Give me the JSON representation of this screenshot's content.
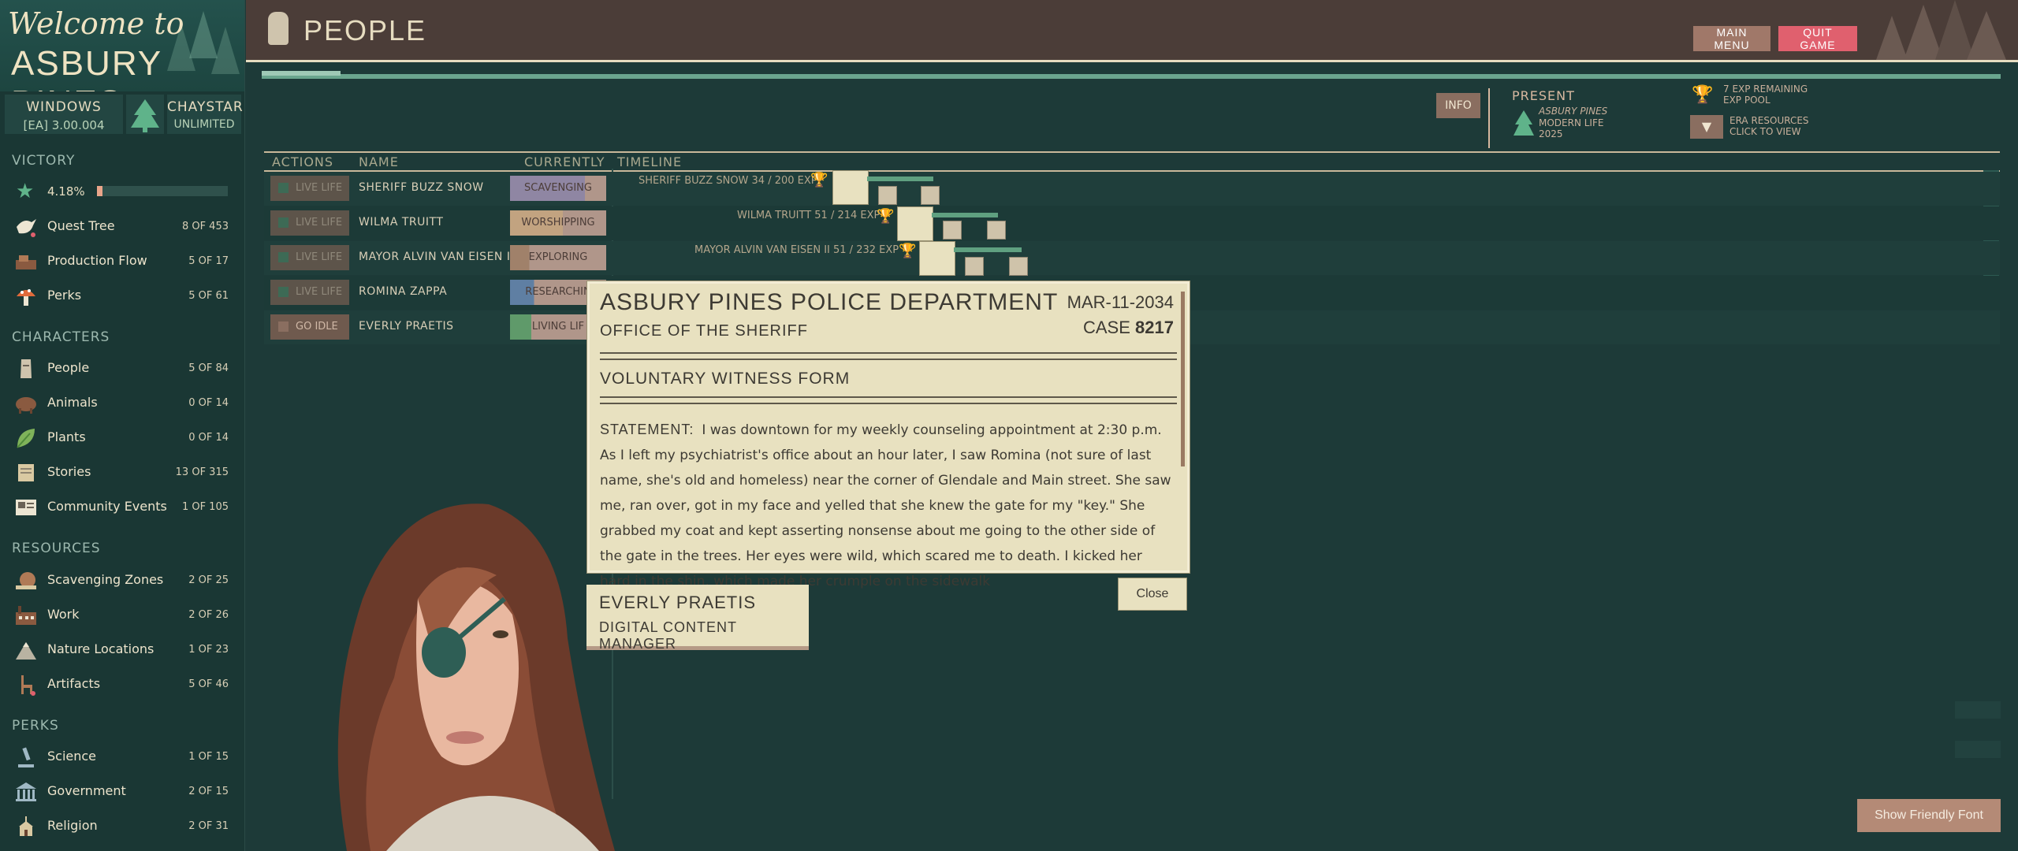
{
  "sidebar": {
    "logo": {
      "line1": "Welcome to",
      "line2": "ASBURY PINES"
    },
    "version": {
      "platform": "WINDOWS",
      "build": "[EA] 3.00.004"
    },
    "chaystar": {
      "name": "CHAYSTAR",
      "status": "UNLIMITED"
    },
    "victory": {
      "header": "VICTORY",
      "percent": "4.18%",
      "progress": 0.0418
    },
    "sections": {
      "victory_items": [
        {
          "label": "Quest Tree",
          "count": "8 OF 453",
          "icon": "dove-icon"
        },
        {
          "label": "Production Flow",
          "count": "5 OF 17",
          "icon": "conveyor-icon"
        },
        {
          "label": "Perks",
          "count": "5 OF 61",
          "icon": "mushroom-icon"
        }
      ],
      "characters_header": "CHARACTERS",
      "characters": [
        {
          "label": "People",
          "count": "5 OF 84",
          "icon": "moai-icon"
        },
        {
          "label": "Animals",
          "count": "0 OF 14",
          "icon": "bison-icon"
        },
        {
          "label": "Plants",
          "count": "0 OF 14",
          "icon": "leaf-icon"
        },
        {
          "label": "Stories",
          "count": "13 OF 315",
          "icon": "scroll-icon"
        },
        {
          "label": "Community Events",
          "count": "1 OF 105",
          "icon": "newspaper-icon"
        }
      ],
      "resources_header": "RESOURCES",
      "resources": [
        {
          "label": "Scavenging Zones",
          "count": "2 OF 25",
          "icon": "snail-icon"
        },
        {
          "label": "Work",
          "count": "2 OF 26",
          "icon": "factory-icon"
        },
        {
          "label": "Nature Locations",
          "count": "1 OF 23",
          "icon": "mountain-icon"
        },
        {
          "label": "Artifacts",
          "count": "5 OF 46",
          "icon": "chair-icon"
        }
      ],
      "perks_header": "PERKS",
      "perks": [
        {
          "label": "Science",
          "count": "1 OF 15",
          "icon": "microscope-icon"
        },
        {
          "label": "Government",
          "count": "2 OF 15",
          "icon": "capitol-icon"
        },
        {
          "label": "Religion",
          "count": "2 OF 31",
          "icon": "church-icon"
        }
      ]
    }
  },
  "header": {
    "title": "PEOPLE",
    "main_menu": "MAIN MENU",
    "quit_game": "QUIT GAME"
  },
  "era": {
    "info": "INFO",
    "present": "PRESENT",
    "location": "ASBURY PINES",
    "era_name": "MODERN LIFE",
    "year": "2025",
    "exp_remaining": "7 EXP REMAINING",
    "exp_pool": "EXP POOL",
    "era_resources": "ERA RESOURCES",
    "click_to_view": "CLICK TO VIEW"
  },
  "table": {
    "columns": [
      "ACTIONS",
      "NAME",
      "CURRENTLY",
      "TIMELINE"
    ],
    "rows": [
      {
        "action": "LIVE LIFE",
        "name": "SHERIFF BUZZ SNOW",
        "currently": "SCAVENGING",
        "timeline": "SHERIFF BUZZ SNOW  34 / 200 EXP"
      },
      {
        "action": "LIVE LIFE",
        "name": "WILMA TRUITT",
        "currently": "WORSHIPPING",
        "timeline": "WILMA TRUITT  51 / 214 EXP"
      },
      {
        "action": "LIVE LIFE",
        "name": "MAYOR ALVIN VAN EISEN II",
        "currently": "EXPLORING",
        "timeline": "MAYOR ALVIN VAN EISEN II  51 / 232 EXP"
      },
      {
        "action": "LIVE LIFE",
        "name": "ROMINA ZAPPA",
        "currently": "RESEARCHIN",
        "timeline": ""
      },
      {
        "action": "GO IDLE",
        "name": "EVERLY PRAETIS",
        "currently": "LIVING LIF",
        "timeline": ""
      }
    ]
  },
  "form": {
    "department": "ASBURY PINES POLICE DEPARTMENT",
    "office": "OFFICE OF THE SHERIFF",
    "date": "MAR-11-2034",
    "case_label": "CASE",
    "case_number": "8217",
    "form_type": "VOLUNTARY WITNESS FORM",
    "statement_label": "STATEMENT:",
    "statement": "I was downtown for my weekly counseling appointment at 2:30 p.m. As I left my psychiatrist's office about an hour later, I saw Romina (not sure of last name, she's old and homeless) near the corner of Glendale and Main street. She saw me, ran over, got in my face and yelled that she knew the gate for my \"key.\" She grabbed my coat and kept asserting nonsense about me going to the other side of the gate in the trees. Her eyes were wild, which scared me to death. I kicked her hard in the shin, which made her crumple on the sidewalk",
    "close": "Close"
  },
  "character": {
    "name": "EVERLY PRAETIS",
    "title": "DIGITAL CONTENT MANAGER"
  },
  "friendly_font": "Show Friendly Font"
}
